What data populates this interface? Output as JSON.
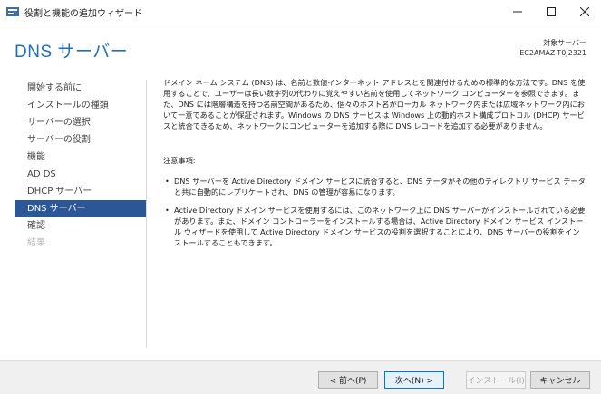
{
  "window": {
    "title": "役割と機能の追加ウィザード"
  },
  "header": {
    "page_title": "DNS サーバー",
    "target_label": "対象サーバー",
    "target_name": "EC2AMAZ-T0J2321"
  },
  "nav": {
    "items": [
      {
        "label": "開始する前に",
        "state": "normal"
      },
      {
        "label": "インストールの種類",
        "state": "normal"
      },
      {
        "label": "サーバーの選択",
        "state": "normal"
      },
      {
        "label": "サーバーの役割",
        "state": "normal"
      },
      {
        "label": "機能",
        "state": "normal"
      },
      {
        "label": "AD DS",
        "state": "normal"
      },
      {
        "label": "DHCP サーバー",
        "state": "normal"
      },
      {
        "label": "DNS サーバー",
        "state": "active"
      },
      {
        "label": "確認",
        "state": "normal"
      },
      {
        "label": "結果",
        "state": "disabled"
      }
    ]
  },
  "content": {
    "intro": "ドメイン ネーム システム (DNS) は、名前と数値インターネット アドレスとを関連付けるための標準的な方法です。DNS を使用することで、ユーザーは長い数字列の代わりに覚えやすい名前を使用してネットワーク コンピューターを参照できます。また、DNS には階層構造を持つ名前空間があるため、個々のホスト名がローカル ネットワーク内または広域ネットワーク内において一意であることが保証されます。Windows の DNS サービスは Windows 上の動的ホスト構成プロトコル (DHCP) サービスと統合できるため、ネットワークにコンピューターを追加する際に DNS レコードを追加する必要がありません。",
    "notes_title": "注意事項:",
    "bullets": [
      "DNS サーバーを Active Directory ドメイン サービスに統合すると、DNS データがその他のディレクトリ サービス データと共に自動的にレプリケートされ、DNS の管理が容易になります。",
      "Active Directory ドメイン サービスを使用するには、このネットワーク上に DNS サーバーがインストールされている必要があります。また、ドメイン コントローラーをインストールする場合は、Active Directory ドメイン サービス インストール ウィザードを使用して Active Directory ドメイン サービスの役割を選択することにより、DNS サーバーの役割をインストールすることもできます。"
    ]
  },
  "footer": {
    "prev_label": "< 前へ(P)",
    "next_label": "次へ(N) >",
    "install_label": "インストール(I)",
    "cancel_label": "キャンセル"
  },
  "colors": {
    "accent": "#1f6fbf",
    "nav_active": "#2b5797"
  }
}
